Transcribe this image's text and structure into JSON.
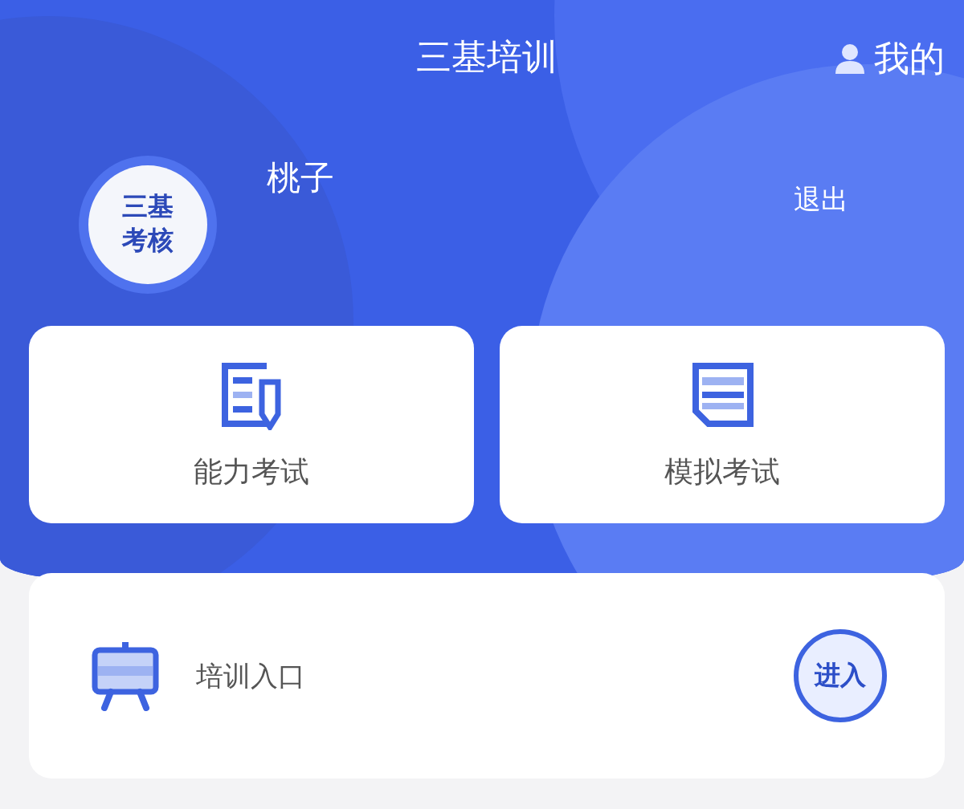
{
  "header": {
    "title": "三基培训",
    "profile_link": "我的"
  },
  "user": {
    "avatar_lines": [
      "三基",
      "考核"
    ],
    "name": "桃子",
    "logout": "退出"
  },
  "tiles": [
    {
      "kind": "exam",
      "label": "能力考试"
    },
    {
      "kind": "mock",
      "label": "模拟考试"
    }
  ],
  "training": {
    "label": "培训入口",
    "button": "进入"
  }
}
